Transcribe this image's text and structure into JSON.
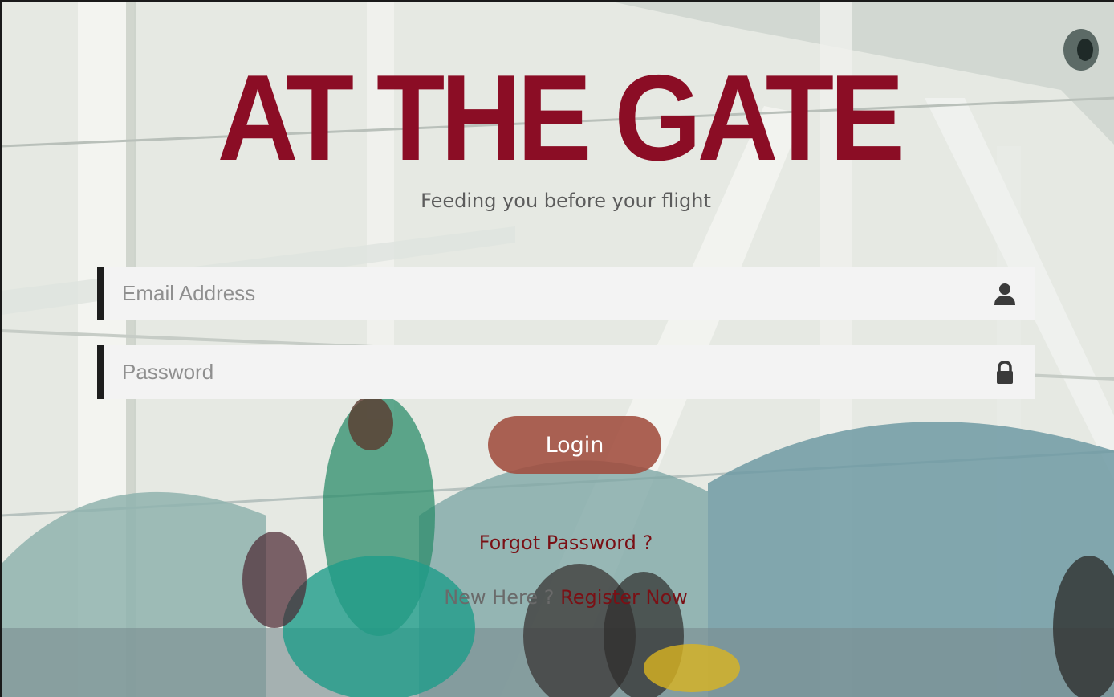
{
  "brand": {
    "title": "AT THE GATE",
    "tagline": "Feeding you before your flight",
    "accent_color": "#8b0d25"
  },
  "form": {
    "email": {
      "placeholder": "Email Address",
      "value": "",
      "icon": "user-icon"
    },
    "password": {
      "placeholder": "Password",
      "value": "",
      "icon": "lock-icon"
    },
    "login_label": "Login"
  },
  "links": {
    "forgot_password": "Forgot Password ?",
    "new_here": "New Here ?",
    "register": "Register Now"
  },
  "background": {
    "description_colors": [
      "#e9ece6",
      "#7fa3a6",
      "#1f8f86",
      "#cfd6d0"
    ]
  }
}
